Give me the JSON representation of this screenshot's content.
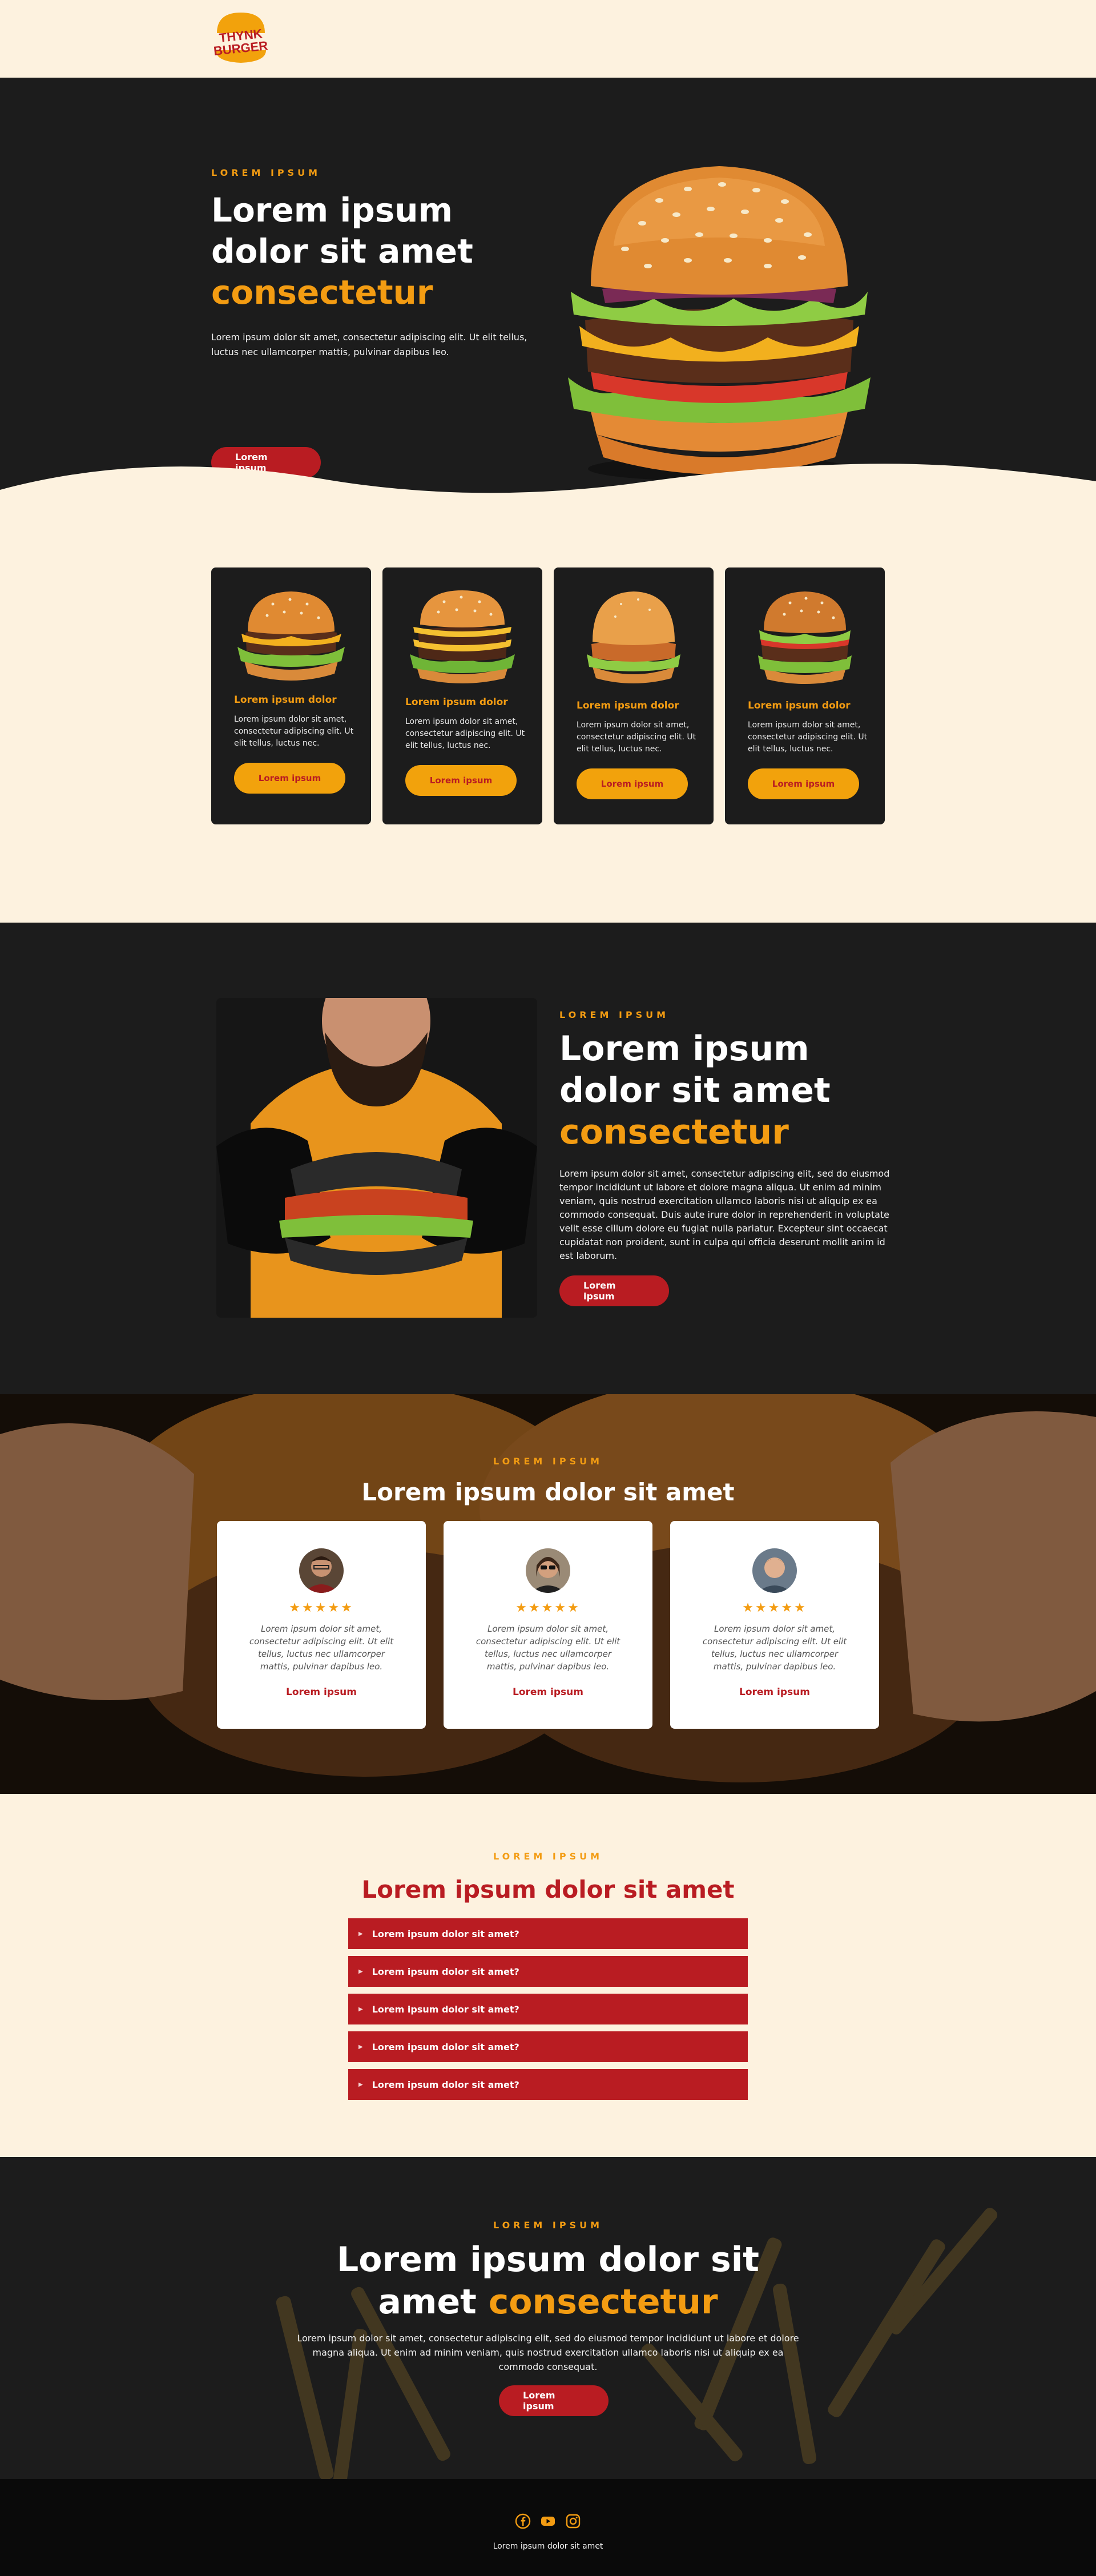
{
  "brand": {
    "logo_line1": "THYNK",
    "logo_line2": "BURGER"
  },
  "hero": {
    "eyebrow": "LOREM IPSUM",
    "title_line1": "Lorem ipsum",
    "title_line2": "dolor sit amet",
    "title_accent": "consectetur",
    "paragraph": "Lorem ipsum dolor sit amet, consectetur adipiscing elit. Ut elit tellus, luctus nec ullamcorper mattis, pulvinar dapibus leo.",
    "button": "Lorem ipsum"
  },
  "products": [
    {
      "title": "Lorem ipsum dolor",
      "desc": "Lorem ipsum dolor sit amet, consectetur adipiscing elit. Ut elit tellus, luctus nec.",
      "button": "Lorem ipsum"
    },
    {
      "title": "Lorem ipsum dolor",
      "desc": "Lorem ipsum dolor sit amet, consectetur adipiscing elit. Ut elit tellus, luctus nec.",
      "button": "Lorem ipsum"
    },
    {
      "title": "Lorem ipsum dolor",
      "desc": "Lorem ipsum dolor sit amet, consectetur adipiscing elit. Ut elit tellus, luctus nec.",
      "button": "Lorem ipsum"
    },
    {
      "title": "Lorem ipsum dolor",
      "desc": "Lorem ipsum dolor sit amet, consectetur adipiscing elit. Ut elit tellus, luctus nec.",
      "button": "Lorem ipsum"
    }
  ],
  "about": {
    "eyebrow": "LOREM IPSUM",
    "title_line1": "Lorem ipsum",
    "title_line2": "dolor sit amet",
    "title_accent": "consectetur",
    "paragraph": "Lorem ipsum dolor sit amet, consectetur adipiscing elit, sed do eiusmod tempor incididunt ut labore et dolore magna aliqua. Ut enim ad minim veniam, quis nostrud exercitation ullamco laboris nisi ut aliquip ex ea commodo consequat. Duis aute irure dolor in reprehenderit in voluptate velit esse cillum dolore eu fugiat nulla pariatur. Excepteur sint occaecat cupidatat non proident, sunt in culpa qui officia deserunt mollit anim id est laborum.",
    "button": "Lorem ipsum"
  },
  "testimonials": {
    "eyebrow": "LOREM IPSUM",
    "title": "Lorem ipsum dolor sit amet",
    "items": [
      {
        "stars": "★★★★★",
        "quote": "Lorem ipsum dolor sit amet, consectetur adipiscing elit. Ut elit tellus, luctus nec ullamcorper mattis, pulvinar dapibus leo.",
        "name": "Lorem ipsum",
        "rating": 5
      },
      {
        "stars": "★★★★★",
        "quote": "Lorem ipsum dolor sit amet, consectetur adipiscing elit. Ut elit tellus, luctus nec ullamcorper mattis, pulvinar dapibus leo.",
        "name": "Lorem ipsum",
        "rating": 5
      },
      {
        "stars": "★★★★★",
        "quote": "Lorem ipsum dolor sit amet, consectetur adipiscing elit. Ut elit tellus, luctus nec ullamcorper mattis, pulvinar dapibus leo.",
        "name": "Lorem ipsum",
        "rating": 5
      }
    ]
  },
  "faq": {
    "eyebrow": "LOREM IPSUM",
    "title": "Lorem ipsum dolor sit amet",
    "items": [
      {
        "question": "Lorem ipsum dolor sit amet?"
      },
      {
        "question": "Lorem ipsum dolor sit amet?"
      },
      {
        "question": "Lorem ipsum dolor sit amet?"
      },
      {
        "question": "Lorem ipsum dolor sit amet?"
      },
      {
        "question": "Lorem ipsum dolor sit amet?"
      }
    ]
  },
  "cta": {
    "eyebrow": "LOREM IPSUM",
    "title_line1": "Lorem ipsum dolor sit",
    "title_line2_plain": "amet",
    "title_line2_accent": "consectetur",
    "paragraph": "Lorem ipsum dolor sit amet, consectetur adipiscing elit, sed do eiusmod tempor incididunt ut labore et dolore magna aliqua. Ut enim ad minim veniam, quis nostrud exercitation ullamco laboris nisi ut aliquip ex ea commodo consequat.",
    "button": "Lorem ipsum"
  },
  "footer": {
    "social_icons": [
      "facebook-icon",
      "youtube-icon",
      "instagram-icon"
    ],
    "text": "Lorem ipsum dolor sit amet"
  },
  "colors": {
    "accent": "#f39c12",
    "brand_red": "#b91c22",
    "dark": "#1c1c1c",
    "cream": "#fdf2df"
  }
}
